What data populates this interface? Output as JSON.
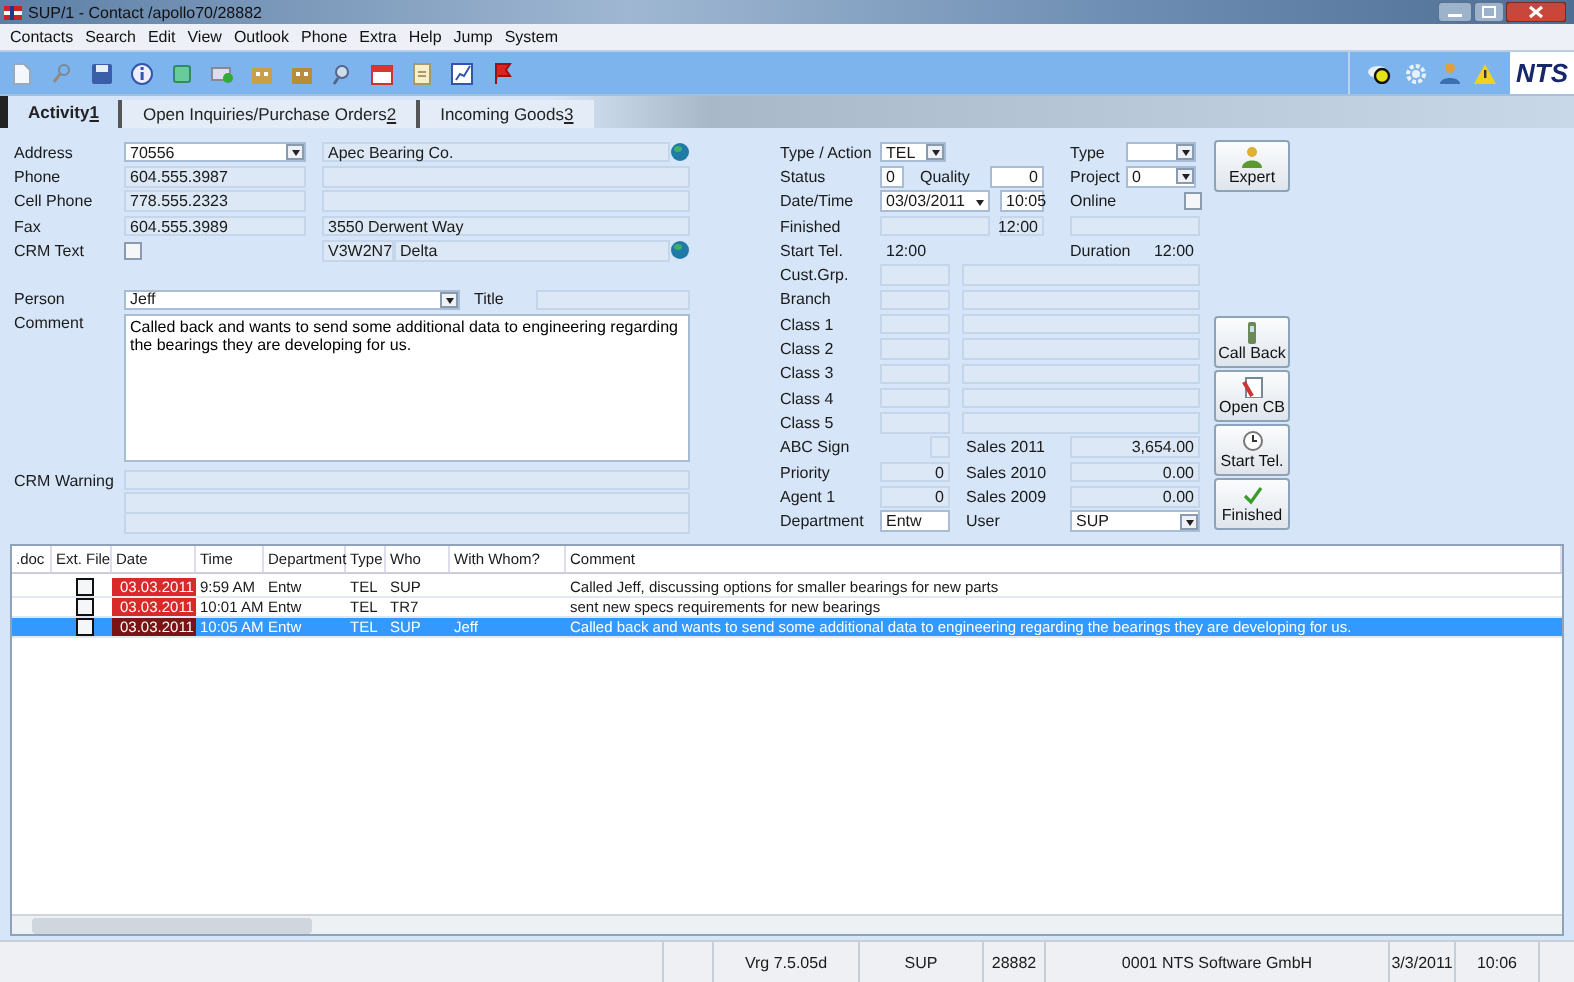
{
  "window": {
    "title": "SUP/1 - Contact /apollo70/28882"
  },
  "menu": [
    "Contacts",
    "Search",
    "Edit",
    "View",
    "Outlook",
    "Phone",
    "Extra",
    "Help",
    "Jump",
    "System"
  ],
  "toolbar": {
    "logo": "NTS"
  },
  "tabs": [
    {
      "label": "Activity",
      "hotkey": "1",
      "selected": true
    },
    {
      "label": "Open Inquiries/Purchase Orders",
      "hotkey": "2",
      "selected": false
    },
    {
      "label": "Incoming Goods",
      "hotkey": "3",
      "selected": false
    }
  ],
  "contact": {
    "address": {
      "label": "Address",
      "number": "70556",
      "company": "Apec Bearing Co."
    },
    "phone": {
      "label": "Phone",
      "value": "604.555.3987"
    },
    "cell_phone": {
      "label": "Cell Phone",
      "value": "778.555.2323"
    },
    "fax": {
      "label": "Fax",
      "value": "604.555.3989",
      "street": "3550 Derwent Way"
    },
    "crm_text": {
      "label": "CRM Text",
      "checked": false,
      "postal_code": "V3W2N7",
      "city": "Delta"
    },
    "person": {
      "label": "Person",
      "value": "Jeff",
      "title_label": "Title"
    },
    "comment": {
      "label": "Comment",
      "value": "Called back and wants to send some additional data to engineering regarding the bearings they are developing for us."
    },
    "crm_warning": {
      "label": "CRM Warning"
    }
  },
  "activity": {
    "type_action": {
      "label": "Type / Action",
      "value": "TEL"
    },
    "type": {
      "label": "Type"
    },
    "status": {
      "label": "Status",
      "value": "0"
    },
    "quality": {
      "label": "Quality",
      "value": "0"
    },
    "project": {
      "label": "Project",
      "value": "0"
    },
    "date_time": {
      "label": "Date/Time",
      "date": "03/03/2011",
      "time": "10:05"
    },
    "online": {
      "label": "Online",
      "checked": false
    },
    "finished": {
      "label": "Finished",
      "time": "12:00"
    },
    "start_tel": {
      "label": "Start Tel.",
      "value": "12:00"
    },
    "duration": {
      "label": "Duration",
      "value": "12:00"
    },
    "classes": [
      {
        "label": "Cust.Grp."
      },
      {
        "label": "Branch"
      },
      {
        "label": "Class 1"
      },
      {
        "label": "Class 2"
      },
      {
        "label": "Class 3"
      },
      {
        "label": "Class 4"
      },
      {
        "label": "Class 5"
      }
    ],
    "abc_sign": {
      "label": "ABC Sign"
    },
    "priority": {
      "label": "Priority",
      "value": "0"
    },
    "agent": {
      "label": "Agent 1",
      "value": "0"
    },
    "department": {
      "label": "Department",
      "value": "Entw"
    },
    "sales": [
      {
        "label": "Sales 2011",
        "value": "3,654.00"
      },
      {
        "label": "Sales 2010",
        "value": "0.00"
      },
      {
        "label": "Sales 2009",
        "value": "0.00"
      }
    ],
    "user": {
      "label": "User",
      "value": "SUP"
    }
  },
  "buttons": [
    {
      "label": "Expert",
      "kind": "person"
    },
    {
      "label": "Call Back",
      "kind": "phone"
    },
    {
      "label": "Open CB",
      "kind": "document"
    },
    {
      "label": "Start Tel.",
      "kind": "clock"
    },
    {
      "label": "Finished",
      "kind": "check"
    }
  ],
  "table": {
    "columns": [
      ".doc",
      "Ext. File",
      "Date",
      "Time",
      "Department",
      "Type",
      "Who",
      "With Whom?",
      "Comment"
    ],
    "rows": [
      {
        "ext_file": false,
        "selected": false,
        "date": "03.03.2011",
        "time": "9:59 AM",
        "department": "Entw",
        "type": "TEL",
        "who": "SUP",
        "comment": "Called Jeff, discussing options for smaller bearings for new parts"
      },
      {
        "ext_file": false,
        "selected": false,
        "date": "03.03.2011",
        "time": "10:01 AM",
        "department": "Entw",
        "type": "TEL",
        "who": "TR7",
        "comment": "sent new specs requirements for new bearings"
      },
      {
        "ext_file": false,
        "selected": true,
        "date": "03.03.2011",
        "time": "10:05 AM",
        "department": "Entw",
        "type": "TEL",
        "who": "SUP",
        "with_whom": "Jeff",
        "comment": "Called back and wants to send some additional data to engineering regarding the bearings they are developing for us."
      }
    ]
  },
  "status_bar": [
    "Vrg 7.5.05d",
    "SUP",
    "28882",
    "0001 NTS Software GmbH",
    "3/3/2011",
    "10:06"
  ]
}
